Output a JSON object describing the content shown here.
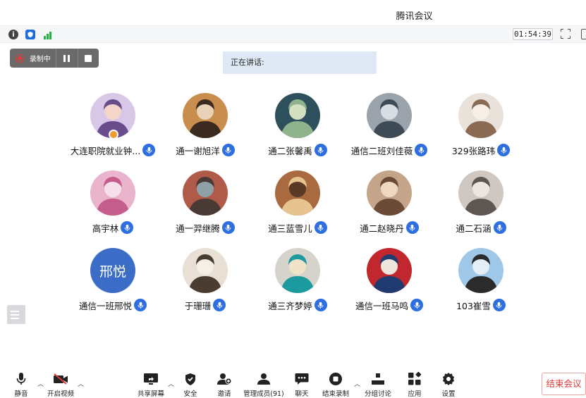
{
  "window": {
    "title": "腾讯会议"
  },
  "infobar": {
    "timer": "01:54:39"
  },
  "recording": {
    "label": "录制中"
  },
  "speaking": {
    "label": "正在讲话:"
  },
  "participants": [
    {
      "name": "大连职院就业钟..."
    },
    {
      "name": "通一谢旭洋"
    },
    {
      "name": "通二张馨禹"
    },
    {
      "name": "通信二班刘佳薇"
    },
    {
      "name": "329张路玮"
    },
    {
      "name": "高宇林"
    },
    {
      "name": "通一羿继腾"
    },
    {
      "name": "通三蓝雪儿"
    },
    {
      "name": "通二赵晓丹"
    },
    {
      "name": "通二石涵"
    },
    {
      "name": "通信一班邢悦",
      "avatar_text": "邢悦"
    },
    {
      "name": "于珊珊"
    },
    {
      "name": "通三齐梦婷"
    },
    {
      "name": "通信一班马鸣"
    },
    {
      "name": "103崔雪"
    }
  ],
  "toolbar": {
    "mute": "静音",
    "video": "开启视频",
    "share": "共享屏幕",
    "security": "安全",
    "invite": "邀请",
    "members": "管理成员(91)",
    "chat": "聊天",
    "record": "结束录制",
    "breakout": "分组讨论",
    "apps": "应用",
    "settings": "设置",
    "end": "结束会议"
  },
  "colors": {
    "accent": "#2d6ee0",
    "danger": "#e03a3a",
    "speaking_bg": "#dfe9f6"
  }
}
